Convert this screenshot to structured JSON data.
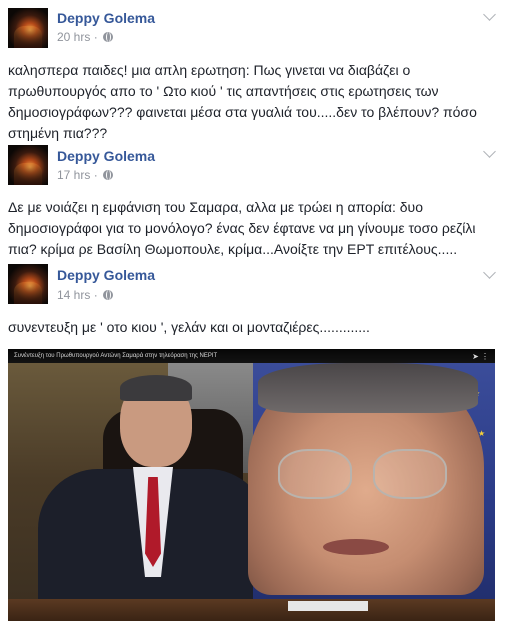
{
  "posts": [
    {
      "author": "Deppy Golema",
      "time": "20 hrs",
      "separator": "·",
      "text": "καλησπερα παιδες! μια απλη ερωτηση: Πως γινεται να διαβάζει ο πρωθυπουργός απο το ' Ωτο κιού ' τις απαντήσεις στις ερωτησεις των δημοσιογράφων??? φαινεται μέσα στα γυαλιά του.....δεν το βλέπουν? πόσο στημένη πια???"
    },
    {
      "author": "Deppy Golema",
      "time": "17 hrs",
      "separator": "·",
      "text": "Δε με νοιάζει η εμφάνιση του Σαμαρα, αλλα με τρώει η απορία: δυο δημοσιογράφοι για το μονόλογο? ένας δεν έφτανε να μη γίνουμε τοσο ρεζίλι πια? κρίμα ρε Βασίλη Θωμοπουλε, κρίμα...Ανοίξτε την ΕΡΤ επιτέλους....."
    },
    {
      "author": "Deppy Golema",
      "time": "14 hrs",
      "separator": "·",
      "text": "συνεντευξη με ' οτο κιου ', γελάν και οι μονταζιέρες............."
    }
  ],
  "video": {
    "title": "Συνέντευξη του Πρωθυπουργού Αντώνη Σαμαρά στην τηλεόραση της ΝΕΡΙΤ",
    "icons": [
      "share-icon",
      "settings-icon"
    ]
  },
  "colors": {
    "author_link": "#365899",
    "meta": "#90949c",
    "body_text": "#1d2129"
  }
}
